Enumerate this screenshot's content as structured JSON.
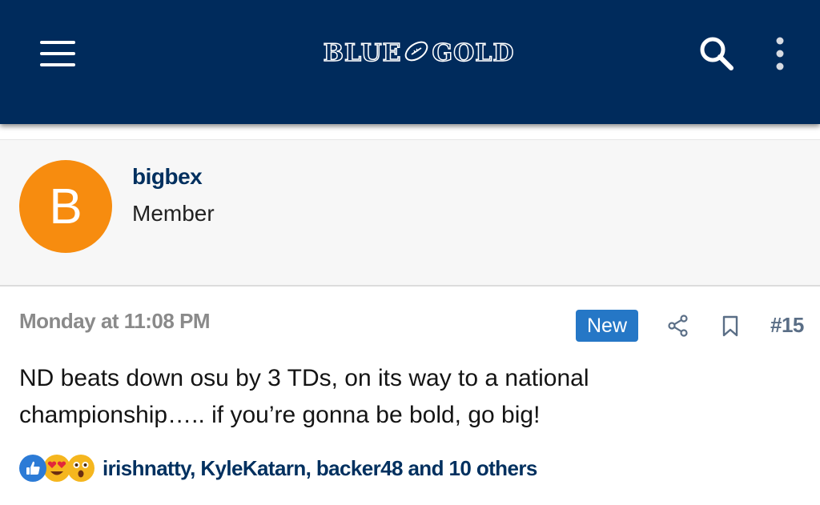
{
  "header": {
    "logo_text_left": "BLUE",
    "logo_text_right": "GOLD",
    "background_color": "#002b5c",
    "menu_icon": "hamburger-icon",
    "search_icon": "search-icon",
    "more_icon": "vertical-dots-icon"
  },
  "author": {
    "avatar_letter": "B",
    "avatar_color": "#f78c0f",
    "username": "bigbex",
    "user_title": "Member"
  },
  "post": {
    "date": "Monday at 11:08 PM",
    "badge": "New",
    "badge_color": "#2577c6",
    "number": "#15",
    "body_line1": "ND beats down osu by 3 TDs, on its way to a national",
    "body_line2": "championship….. if you’re gonna be bold, go big!"
  },
  "reactions": {
    "icons": [
      "thumbs-up-icon",
      "heart-eyes-icon",
      "astonished-icon"
    ],
    "text": "irishnatty, KyleKatarn, backer48 and 10 others"
  }
}
